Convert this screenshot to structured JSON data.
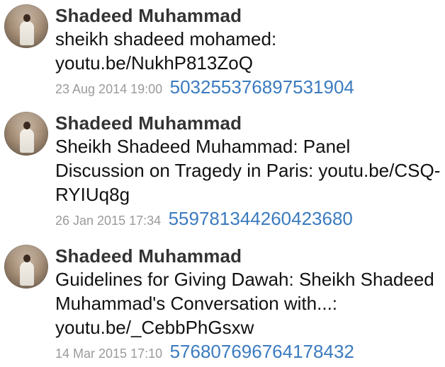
{
  "tweets": [
    {
      "author": "Shadeed Muhammad",
      "text": "sheikh shadeed mohamed: youtu.be/NukhP813ZoQ",
      "date": "23 Aug 2014 19:00",
      "id": "503255376897531904"
    },
    {
      "author": "Shadeed Muhammad",
      "text": "Sheikh Shadeed Muhammad: Panel Discussion on Tragedy in Paris: youtu.be/CSQ-RYIUq8g",
      "date": "26 Jan 2015 17:34",
      "id": "559781344260423680"
    },
    {
      "author": "Shadeed Muhammad",
      "text": "Guidelines for Giving Dawah: Sheikh Shadeed Muhammad's Conversation with...: youtu.be/_CebbPhGsxw",
      "date": "14 Mar 2015 17:10",
      "id": "576807696764178432"
    }
  ]
}
